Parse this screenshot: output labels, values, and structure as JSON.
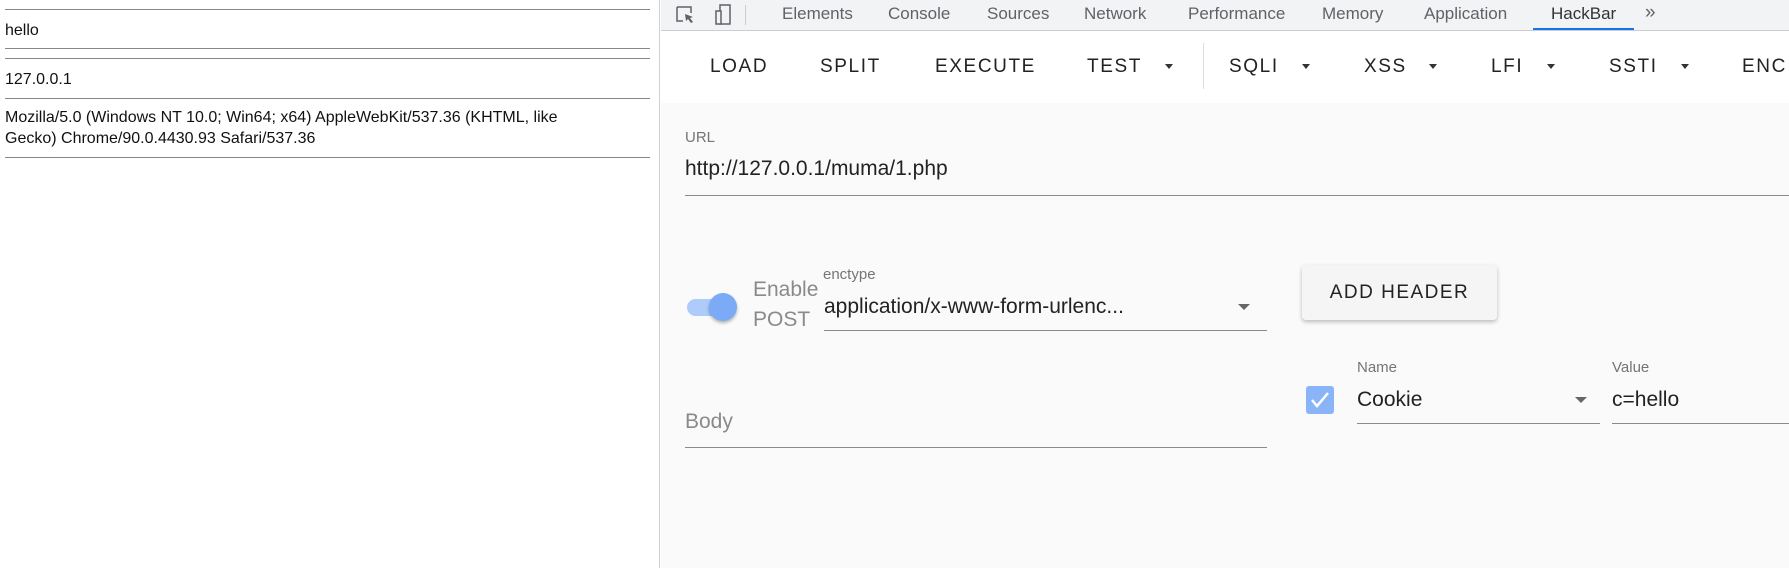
{
  "page": {
    "lines": [
      "hello",
      "127.0.0.1",
      "Mozilla/5.0 (Windows NT 10.0; Win64; x64) AppleWebKit/537.36 (KHTML, like",
      "Gecko) Chrome/90.0.4430.93 Safari/537.36"
    ]
  },
  "devtools": {
    "tabs": [
      "Elements",
      "Console",
      "Sources",
      "Network",
      "Performance",
      "Memory",
      "Application",
      "HackBar"
    ],
    "active_tab": "HackBar",
    "more": "»",
    "accent": "#1a73e8"
  },
  "hackbar": {
    "toolbar": {
      "load": "LOAD",
      "split": "SPLIT",
      "execute": "EXECUTE",
      "test": "TEST",
      "sqli": "SQLI",
      "xss": "XSS",
      "lfi": "LFI",
      "ssti": "SSTI",
      "enc": "ENC"
    },
    "url_label": "URL",
    "url_value": "http://127.0.0.1/muma/1.php",
    "enable_post_label_1": "Enable",
    "enable_post_label_2": "POST",
    "enable_post": true,
    "enctype_label": "enctype",
    "enctype_value": "application/x-www-form-urlenc...",
    "add_header": "ADD HEADER",
    "body_placeholder": "Body",
    "header": {
      "enabled": true,
      "name_label": "Name",
      "name_value": "Cookie",
      "value_label": "Value",
      "value_value": "c=hello"
    },
    "toggle_color": "#7baaf7",
    "checkbox_color": "#8ab4f8"
  }
}
